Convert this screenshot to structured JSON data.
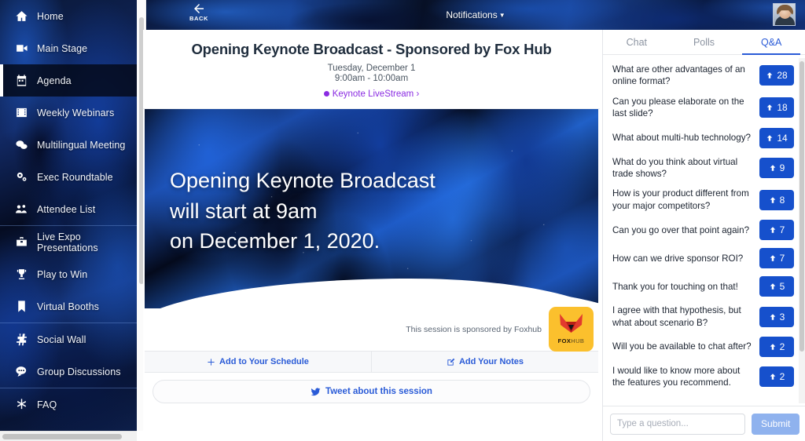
{
  "sidebar": {
    "groups": [
      {
        "items": [
          {
            "label": "Home",
            "icon": "home-icon",
            "active": false
          },
          {
            "label": "Main Stage",
            "icon": "video-camera-icon",
            "active": false
          },
          {
            "label": "Agenda",
            "icon": "calendar-icon",
            "active": true
          },
          {
            "label": "Weekly Webinars",
            "icon": "film-icon",
            "active": false
          },
          {
            "label": "Multilingual Meeting",
            "icon": "chat-bubbles-icon",
            "active": false
          },
          {
            "label": "Exec Roundtable",
            "icon": "gears-icon",
            "active": false
          },
          {
            "label": "Attendee List",
            "icon": "people-icon",
            "active": false
          }
        ]
      },
      {
        "items": [
          {
            "label": "Live Expo Presentations",
            "icon": "briefcase-icon",
            "active": false
          },
          {
            "label": "Play to Win",
            "icon": "trophy-icon",
            "active": false
          },
          {
            "label": "Virtual Booths",
            "icon": "bookmark-icon",
            "active": false
          }
        ]
      },
      {
        "items": [
          {
            "label": "Social Wall",
            "icon": "hashtag-icon",
            "active": false
          },
          {
            "label": "Group Discussions",
            "icon": "comment-dots-icon",
            "active": false
          }
        ]
      },
      {
        "items": [
          {
            "label": "FAQ",
            "icon": "asterisk-icon",
            "active": false
          }
        ]
      }
    ]
  },
  "topbar": {
    "back_label": "BACK",
    "notifications_label": "Notifications",
    "notifications_caret": "▼"
  },
  "session": {
    "title": "Opening Keynote Broadcast - Sponsored by Fox Hub",
    "date": "Tuesday, December 1",
    "time": "9:00am - 10:00am",
    "stream_link": "Keynote LiveStream ›",
    "banner_text": "Opening Keynote Broadcast\nwill start at 9am\non December 1, 2020.",
    "sponsor_note": "This session is sponsored by Foxhub",
    "sponsor_logo_bold": "FOX",
    "sponsor_logo_light": "HUB"
  },
  "actions": {
    "add_schedule": "Add to Your Schedule",
    "add_notes": "Add Your Notes",
    "tweet": "Tweet about this session"
  },
  "right_panel": {
    "tabs": [
      {
        "label": "Chat",
        "active": false
      },
      {
        "label": "Polls",
        "active": false
      },
      {
        "label": "Q&A",
        "active": true
      }
    ],
    "questions": [
      {
        "text": "What are other advantages of an online format?",
        "votes": "28"
      },
      {
        "text": "Can you please elaborate on the last slide?",
        "votes": "18"
      },
      {
        "text": "What about multi-hub technology?",
        "votes": "14"
      },
      {
        "text": "What do you think about virtual trade shows?",
        "votes": "9"
      },
      {
        "text": "How is your product different from your major competitors?",
        "votes": "8"
      },
      {
        "text": "Can you go over that point again?",
        "votes": "7"
      },
      {
        "text": "How can we drive sponsor ROI?",
        "votes": "7"
      },
      {
        "text": "Thank you for touching on that!",
        "votes": "5"
      },
      {
        "text": "I agree with that hypothesis, but what about scenario B?",
        "votes": "3"
      },
      {
        "text": "Will you be available to chat after?",
        "votes": "2"
      },
      {
        "text": "I would like to know more about the features you recommend.",
        "votes": "2"
      }
    ],
    "compose": {
      "placeholder": "Type a question...",
      "value": "",
      "submit_label": "Submit"
    }
  },
  "colors": {
    "accent_blue": "#2a5bd7",
    "vote_blue": "#1650cc",
    "link_purple": "#8a2be2",
    "sponsor_yellow": "#fbc02d"
  }
}
